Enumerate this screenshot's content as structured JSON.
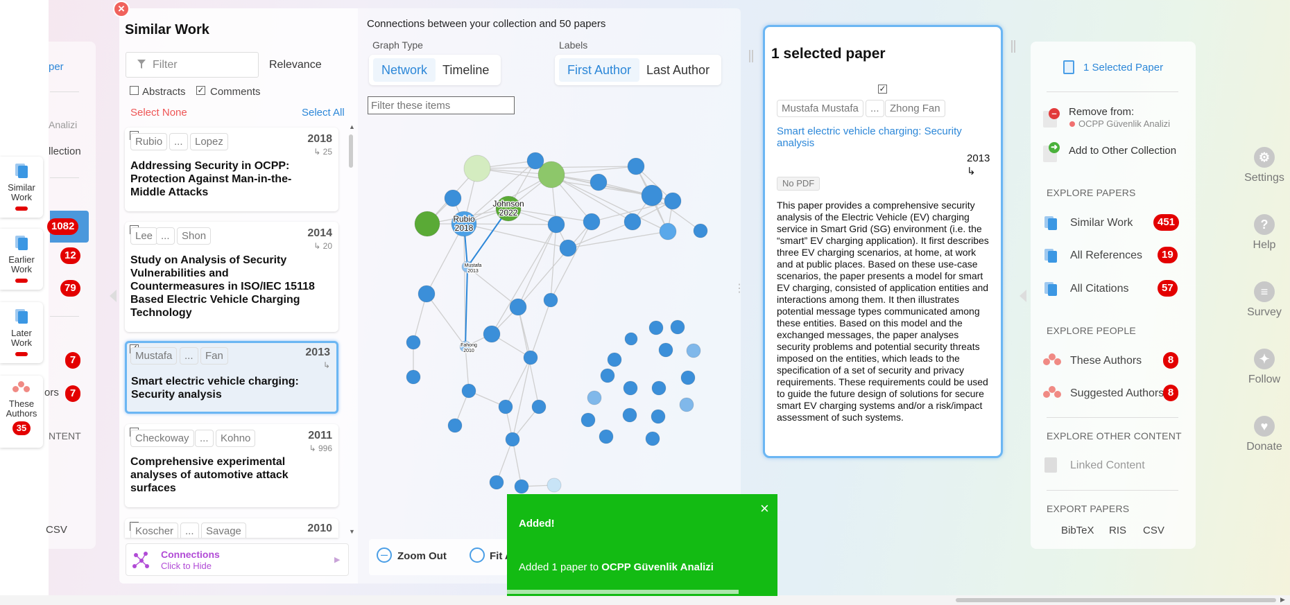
{
  "left_tabs": [
    {
      "label_1": "Similar",
      "label_2": "Work"
    },
    {
      "label_1": "Earlier",
      "label_2": "Work"
    },
    {
      "label_1": "Later",
      "label_2": "Work"
    },
    {
      "label_1": "These",
      "label_2": "Authors",
      "badge": "35"
    }
  ],
  "back_panel": {
    "partial_top": "per",
    "partial_1": "Analizi",
    "partial_2": "llection",
    "badges": [
      "1082",
      "12",
      "79",
      "7",
      "7"
    ],
    "partial_3": "ors",
    "partial_4": "NTENT",
    "partial_5": "CSV"
  },
  "similar_work": {
    "title": "Similar Work",
    "filter_placeholder": "Filter",
    "sort": "Relevance",
    "abstracts": "Abstracts",
    "comments": "Comments",
    "select_none": "Select None",
    "select_all": "Select All",
    "cards": [
      {
        "first": "Rubio",
        "ellipsis": "...",
        "last": "Lopez",
        "year": "2018",
        "cites": "↳ 25",
        "title_lines": [
          "Addressing Security in OCPP:",
          "Protection Against Man-in-the-",
          "Middle Attacks"
        ]
      },
      {
        "first": "Lee",
        "ellipsis": "...",
        "last": "Shon",
        "year": "2014",
        "cites": "↳ 20",
        "title_lines": [
          "Study on Analysis of Security",
          "Vulnerabilities and",
          "Countermeasures in ISO/IEC 15118",
          "Based Electric Vehicle Charging",
          "Technology"
        ]
      },
      {
        "first": "Mustafa",
        "ellipsis": "...",
        "last": "Fan",
        "year": "2013",
        "cites": "↳",
        "title_lines": [
          "Smart electric vehicle charging:",
          "Security analysis"
        ]
      },
      {
        "first": "Checkoway",
        "ellipsis": "...",
        "last": "Kohno",
        "year": "2011",
        "cites": "↳ 996",
        "title_lines": [
          "Comprehensive experimental",
          "analyses of automotive attack",
          "surfaces"
        ]
      },
      {
        "first": "Koscher",
        "ellipsis": "...",
        "last": "Savage",
        "year": "2010",
        "cites": "",
        "title_lines": []
      }
    ],
    "connections_title": "Connections",
    "connections_sub": "Click to Hide"
  },
  "graph": {
    "header": "Connections between your collection and 50 papers",
    "graph_type_label": "Graph Type",
    "graph_type_options": [
      "Network",
      "Timeline"
    ],
    "labels_label": "Labels",
    "labels_options": [
      "First Author",
      "Last Author"
    ],
    "filter_placeholder": "Filter these items",
    "node_labels": [
      {
        "name": "Rubio",
        "year": "2018"
      },
      {
        "name": "Johnson",
        "year": "2022"
      },
      {
        "name": "Mustafa",
        "year": "2013"
      },
      {
        "name": "Fahong",
        "year": "2010"
      }
    ],
    "zoom_out": "Zoom Out",
    "fit": "Fit A"
  },
  "selected_paper": {
    "title": "1 selected paper",
    "first_author": "Mustafa Mustafa",
    "ellipsis": "...",
    "last_author": "Zhong Fan",
    "paper_title": "Smart electric vehicle charging: Security analysis",
    "year": "2013",
    "cites": "↳",
    "pdf": "No PDF",
    "abstract": "This paper provides a comprehensive security analysis of the Electric Vehicle (EV) charging service in Smart Grid (SG) environment (i.e. the “smart” EV charging application). It first describes three EV charging scenarios, at home, at work and at public places. Based on these use-case scenarios, the paper presents a model for smart EV charging, consisted of application entities and interactions among them. It then illustrates potential message types communicated among these entities. Based on this model and the exchanged messages, the paper analyses security problems and potential security threats imposed on the entities, which leads to the specification of a set of security and privacy requirements. These requirements could be used to guide the future design of solutions for secure smart EV charging systems and/or a risk/impact assessment of such systems."
  },
  "right_panel": {
    "selected": "1 Selected Paper",
    "remove_from": "Remove from:",
    "collection": "OCPP Güvenlik Analizi",
    "add_to_other": "Add to Other Collection",
    "explore_papers": "EXPLORE PAPERS",
    "similar_work": "Similar Work",
    "similar_count": "451",
    "all_references": "All References",
    "references_count": "19",
    "all_citations": "All Citations",
    "citations_count": "57",
    "explore_people": "EXPLORE PEOPLE",
    "these_authors": "These Authors",
    "these_count": "8",
    "suggested_authors": "Suggested Authors",
    "suggested_count": "8",
    "explore_other": "EXPLORE OTHER CONTENT",
    "linked_content": "Linked Content",
    "export_papers": "EXPORT PAPERS",
    "exports": [
      "BibTeX",
      "RIS",
      "CSV"
    ]
  },
  "far_right": [
    {
      "label": "Settings",
      "icon": "gear-icon"
    },
    {
      "label": "Help",
      "icon": "question-icon"
    },
    {
      "label": "Survey",
      "icon": "chat-icon"
    },
    {
      "label": "Follow",
      "icon": "twitter-icon"
    },
    {
      "label": "Donate",
      "icon": "heart-icon"
    }
  ],
  "toast": {
    "title": "Added!",
    "message_prefix": "Added 1 paper to ",
    "collection": "OCPP Güvenlik Analizi",
    "close": "×"
  },
  "colors": {
    "accent": "#2c87d8",
    "red": "#e30000",
    "toast_green": "#13bb13",
    "node_blue": "#3b8fd9",
    "node_green": "#5aaa36"
  }
}
